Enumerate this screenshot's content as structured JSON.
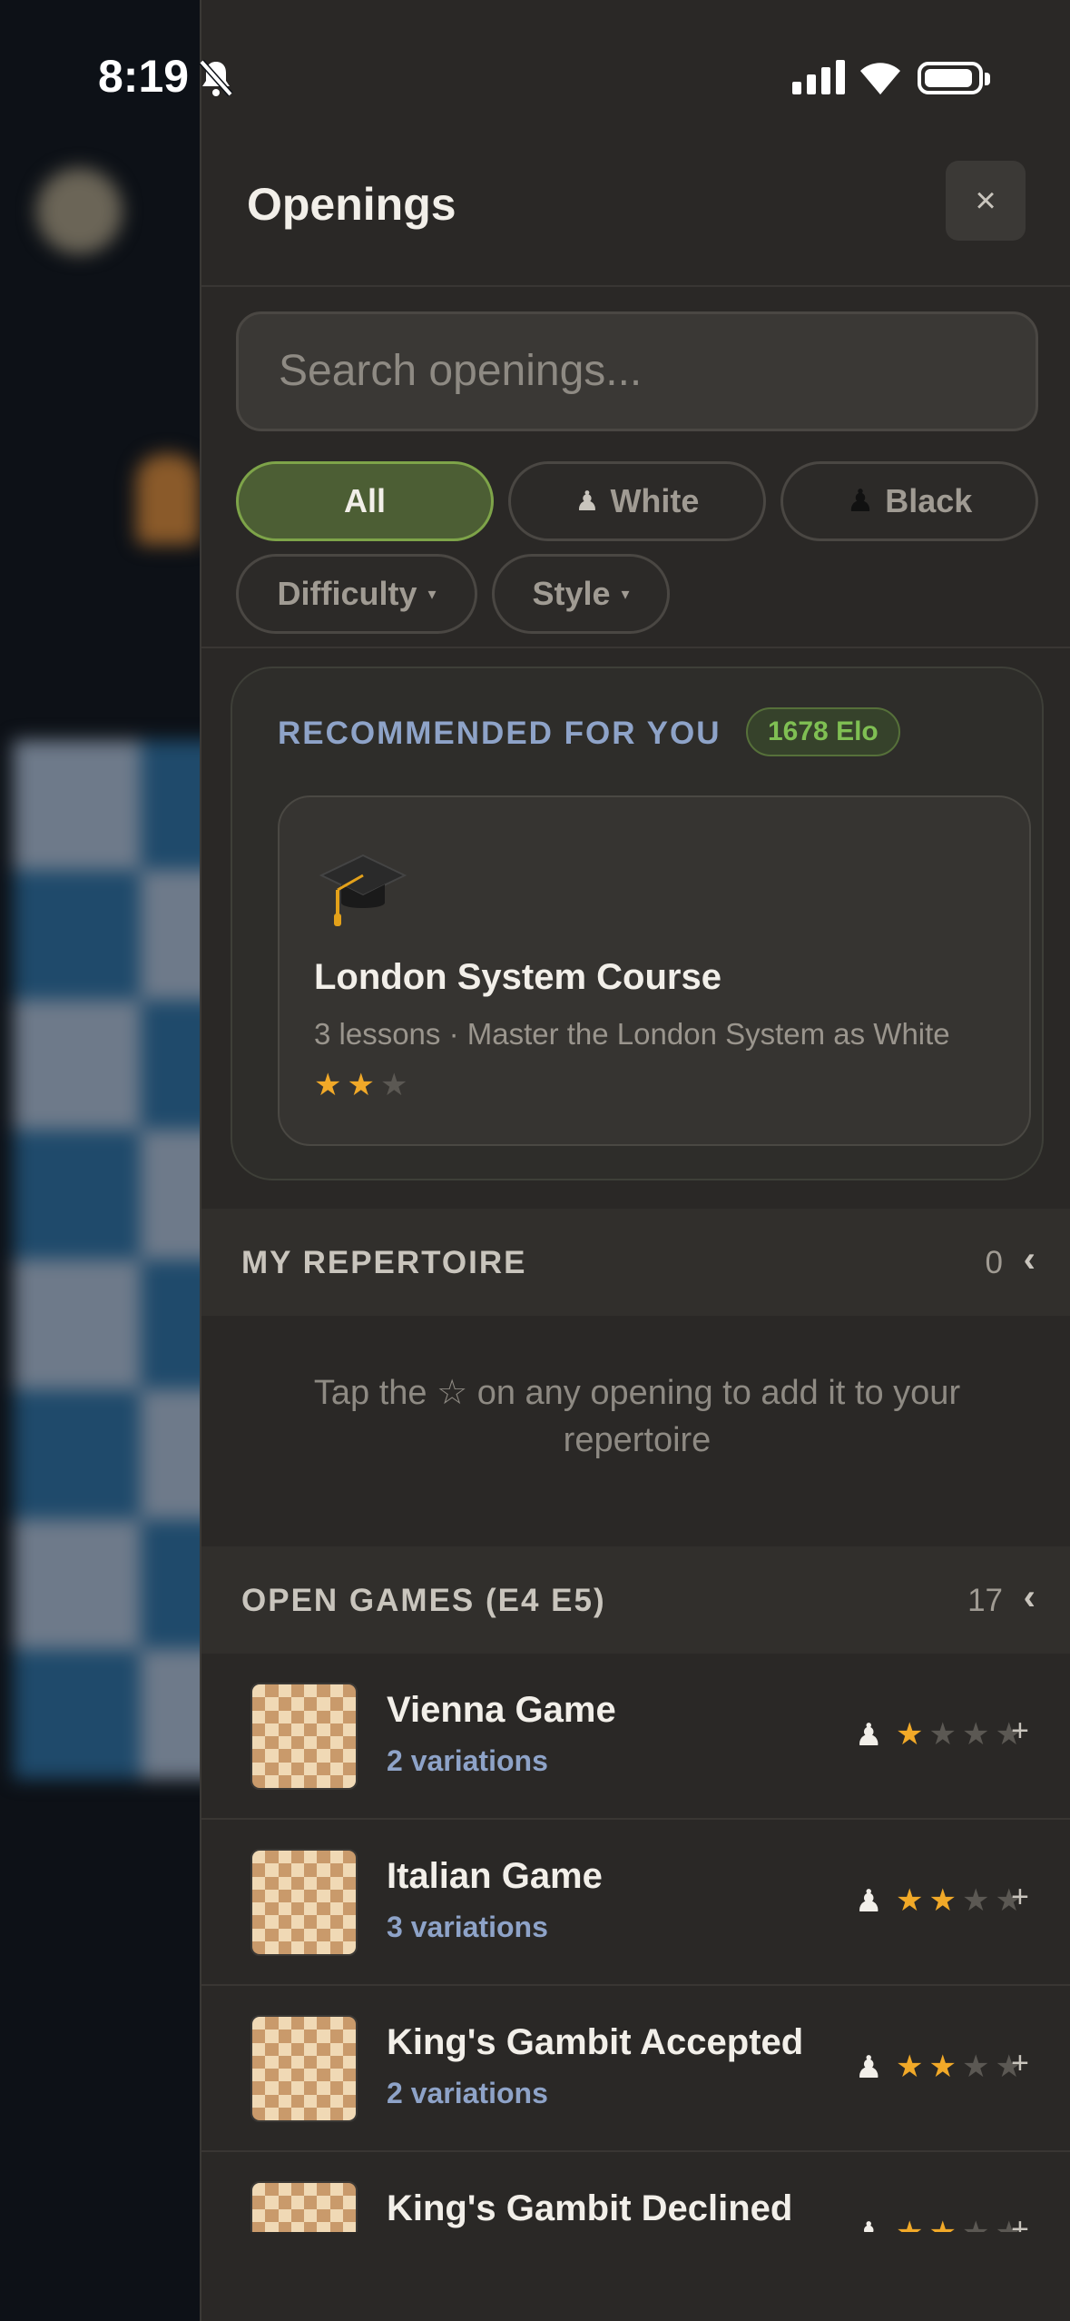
{
  "status": {
    "time": "8:19"
  },
  "drawer": {
    "title": "Openings",
    "close": "×"
  },
  "search": {
    "placeholder": "Search openings..."
  },
  "filters": {
    "all": "All",
    "white": "White",
    "black": "Black",
    "difficulty": "Difficulty",
    "style": "Style",
    "white_icon": "♟",
    "black_icon": "♟",
    "caret": "▾"
  },
  "recommended": {
    "label": "RECOMMENDED FOR YOU",
    "elo": "1678 Elo",
    "course": {
      "title": "London System Course",
      "subtitle": "3 lessons · Master the London System as White",
      "rating": 2,
      "max_rating": 3
    }
  },
  "repertoire": {
    "label": "MY REPERTOIRE",
    "count": "0",
    "chevron": "‹",
    "empty": "Tap the ☆ on any opening to add it to your repertoire"
  },
  "open_games": {
    "label": "OPEN GAMES (E4 E5)",
    "count": "17",
    "chevron": "‹",
    "items": [
      {
        "title": "Vienna Game",
        "sub": "2 variations",
        "side_icon": "♟",
        "rating": 1,
        "max_rating": 4,
        "add": "+"
      },
      {
        "title": "Italian Game",
        "sub": "3 variations",
        "side_icon": "♟",
        "rating": 2,
        "max_rating": 4,
        "add": "+"
      },
      {
        "title": "King's Gambit Accepted",
        "sub": "2 variations",
        "side_icon": "♟",
        "rating": 2,
        "max_rating": 4,
        "add": "+"
      },
      {
        "title": "King's Gambit Declined",
        "sub": "",
        "side_icon": "♟",
        "rating": 2,
        "max_rating": 4,
        "add": "+"
      }
    ]
  },
  "colors": {
    "accent_green": "#7ea449",
    "star": "#f1a928",
    "link_blue": "#8ea3c8"
  }
}
